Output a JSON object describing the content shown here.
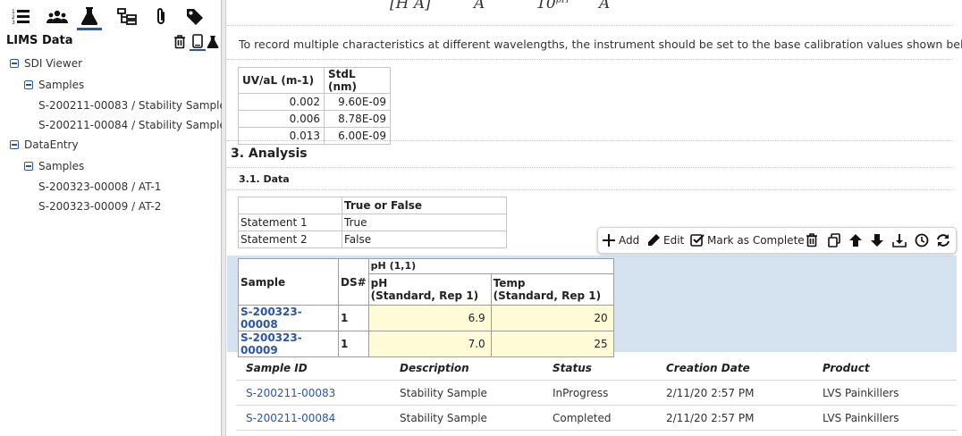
{
  "left_panel": {
    "title": "LIMS Data",
    "tree": [
      {
        "label": "SDI Viewer",
        "level": 0,
        "expandable": true
      },
      {
        "label": "Samples",
        "level": 1,
        "expandable": true
      },
      {
        "label": "S-200211-00083 / Stability Sample",
        "level": 2,
        "expandable": false
      },
      {
        "label": "S-200211-00084 / Stability Sample",
        "level": 2,
        "expandable": false
      },
      {
        "label": "DataEntry",
        "level": 0,
        "expandable": true
      },
      {
        "label": "Samples",
        "level": 1,
        "expandable": true
      },
      {
        "label": "S-200323-00008 / AT-1",
        "level": 2,
        "expandable": false
      },
      {
        "label": "S-200323-00009 / AT-2",
        "level": 2,
        "expandable": false
      }
    ]
  },
  "formula": {
    "p1": "[H A]",
    "p2": "A",
    "p3": "10",
    "p3_sup": "pH",
    "p4": "A"
  },
  "intro_text": "To record multiple characteristics at different wavelengths, the instrument should be set to the base calibration values shown below.",
  "calibration_table": {
    "headers": [
      "UV/aL (m-1)",
      "StdL (nm)"
    ],
    "rows": [
      [
        "0.002",
        "9.60E-09"
      ],
      [
        "0.006",
        "8.78E-09"
      ],
      [
        "0.013",
        "6.00E-09"
      ]
    ]
  },
  "section_3": "3.  Analysis",
  "section_31": "3.1.   Data",
  "tf_table": {
    "header": "True or False",
    "rows": [
      [
        "Statement 1",
        "True"
      ],
      [
        "Statement 2",
        "False"
      ]
    ]
  },
  "toolbar": {
    "add": "Add",
    "edit": "Edit",
    "mark_complete": "Mark as Complete"
  },
  "ph_table": {
    "col_sample": "Sample",
    "col_ds": "DS#",
    "group": "pH (1,1)",
    "col_ph_l1": "pH",
    "col_ph_l2": "(Standard, Rep 1)",
    "col_temp_l1": "Temp",
    "col_temp_l2": "(Standard, Rep 1)",
    "rows": [
      {
        "sample": "S-200323-00008",
        "ds": "1",
        "ph": "6.9",
        "temp": "20"
      },
      {
        "sample": "S-200323-00009",
        "ds": "1",
        "ph": "7.0",
        "temp": "25"
      }
    ]
  },
  "sample_list": {
    "headers": [
      "Sample ID",
      "Description",
      "Status",
      "Creation Date",
      "Product"
    ],
    "rows": [
      [
        "S-200211-00083",
        "Stability Sample",
        "InProgress",
        "2/11/20 2:57 PM",
        "LVS Painkillers"
      ],
      [
        "S-200211-00084",
        "Stability Sample",
        "Completed",
        "2/11/20 2:57 PM",
        "LVS Painkillers"
      ]
    ]
  },
  "colors": {
    "accent": "#2a56a8",
    "data_area": "#d5e3f1",
    "input_bg": "#fffbd6"
  }
}
